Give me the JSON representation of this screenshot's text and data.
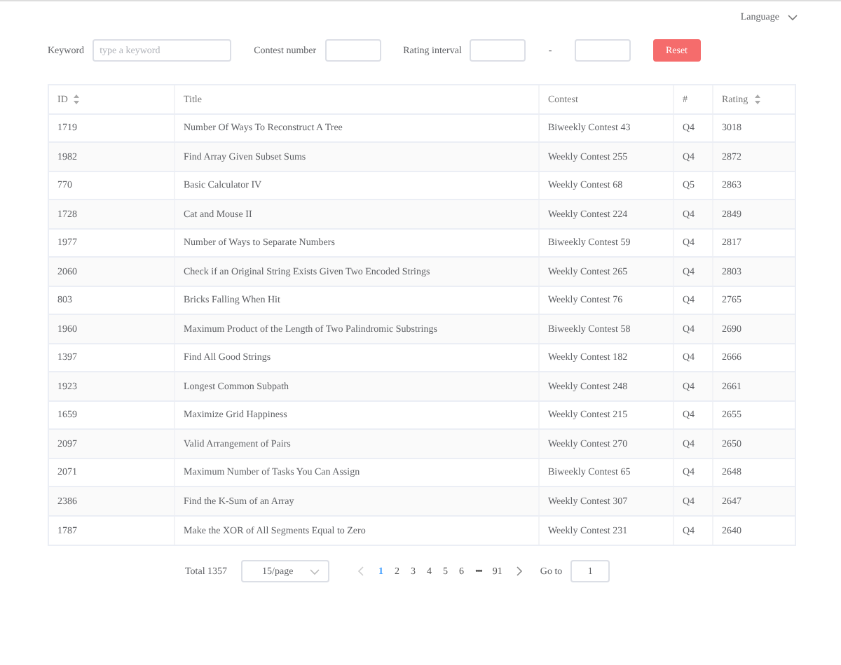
{
  "language": {
    "label": "Language"
  },
  "filters": {
    "keyword_label": "Keyword",
    "keyword_placeholder": "type a keyword",
    "contest_label": "Contest number",
    "rating_label": "Rating interval",
    "range_separator": "-",
    "reset": "Reset"
  },
  "table": {
    "columns": [
      {
        "label": "ID",
        "sortable": true
      },
      {
        "label": "Title",
        "sortable": false
      },
      {
        "label": "Contest",
        "sortable": false
      },
      {
        "label": "#",
        "sortable": false
      },
      {
        "label": "Rating",
        "sortable": true
      }
    ],
    "rows": [
      [
        "1719",
        "Number Of Ways To Reconstruct A Tree",
        "Biweekly Contest 43",
        "Q4",
        "3018"
      ],
      [
        "1982",
        "Find Array Given Subset Sums",
        "Weekly Contest 255",
        "Q4",
        "2872"
      ],
      [
        "770",
        "Basic Calculator IV",
        "Weekly Contest 68",
        "Q5",
        "2863"
      ],
      [
        "1728",
        "Cat and Mouse II",
        "Weekly Contest 224",
        "Q4",
        "2849"
      ],
      [
        "1977",
        "Number of Ways to Separate Numbers",
        "Biweekly Contest 59",
        "Q4",
        "2817"
      ],
      [
        "2060",
        "Check if an Original String Exists Given Two Encoded Strings",
        "Weekly Contest 265",
        "Q4",
        "2803"
      ],
      [
        "803",
        "Bricks Falling When Hit",
        "Weekly Contest 76",
        "Q4",
        "2765"
      ],
      [
        "1960",
        "Maximum Product of the Length of Two Palindromic Substrings",
        "Biweekly Contest 58",
        "Q4",
        "2690"
      ],
      [
        "1397",
        "Find All Good Strings",
        "Weekly Contest 182",
        "Q4",
        "2666"
      ],
      [
        "1923",
        "Longest Common Subpath",
        "Weekly Contest 248",
        "Q4",
        "2661"
      ],
      [
        "1659",
        "Maximize Grid Happiness",
        "Weekly Contest 215",
        "Q4",
        "2655"
      ],
      [
        "2097",
        "Valid Arrangement of Pairs",
        "Weekly Contest 270",
        "Q4",
        "2650"
      ],
      [
        "2071",
        "Maximum Number of Tasks You Can Assign",
        "Biweekly Contest 65",
        "Q4",
        "2648"
      ],
      [
        "2386",
        "Find the K-Sum of an Array",
        "Weekly Contest 307",
        "Q4",
        "2647"
      ],
      [
        "1787",
        "Make the XOR of All Segments Equal to Zero",
        "Weekly Contest 231",
        "Q4",
        "2640"
      ]
    ]
  },
  "pagination": {
    "total": "Total 1357",
    "page_size": "15/page",
    "prev_disabled": true,
    "pages": [
      {
        "label": "1",
        "kind": "page",
        "selected": true
      },
      {
        "label": "2",
        "kind": "page",
        "selected": false
      },
      {
        "label": "3",
        "kind": "page",
        "selected": false
      },
      {
        "label": "4",
        "kind": "page",
        "selected": false
      },
      {
        "label": "5",
        "kind": "page",
        "selected": false
      },
      {
        "label": "6",
        "kind": "page",
        "selected": false
      },
      {
        "label": "•••",
        "kind": "more"
      },
      {
        "label": "91",
        "kind": "page",
        "selected": false
      }
    ],
    "goto_label": "Go to",
    "goto_value": "1"
  }
}
